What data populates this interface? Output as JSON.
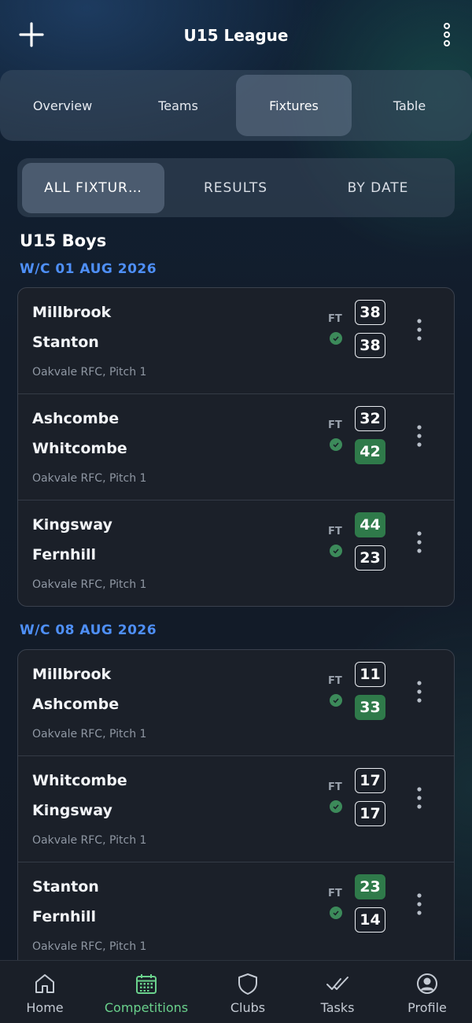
{
  "header": {
    "title": "U15 League"
  },
  "tabs": [
    {
      "label": "Overview"
    },
    {
      "label": "Teams"
    },
    {
      "label": "Fixtures"
    },
    {
      "label": "Table"
    }
  ],
  "filters": [
    {
      "label": "ALL FIXTUR…"
    },
    {
      "label": "RESULTS"
    },
    {
      "label": "BY DATE"
    }
  ],
  "group": {
    "title": "U15 Boys"
  },
  "weeks": [
    {
      "label": "W/C 01 AUG 2026",
      "matches": [
        {
          "home": "Millbrook",
          "away": "Stanton",
          "venue": "Oakvale RFC, Pitch 1",
          "status": "FT",
          "home_score": "38",
          "away_score": "38",
          "winner": "none"
        },
        {
          "home": "Ashcombe",
          "away": "Whitcombe",
          "venue": "Oakvale RFC, Pitch 1",
          "status": "FT",
          "home_score": "32",
          "away_score": "42",
          "winner": "away"
        },
        {
          "home": "Kingsway",
          "away": "Fernhill",
          "venue": "Oakvale RFC, Pitch 1",
          "status": "FT",
          "home_score": "44",
          "away_score": "23",
          "winner": "home"
        }
      ]
    },
    {
      "label": "W/C 08 AUG 2026",
      "matches": [
        {
          "home": "Millbrook",
          "away": "Ashcombe",
          "venue": "Oakvale RFC, Pitch 1",
          "status": "FT",
          "home_score": "11",
          "away_score": "33",
          "winner": "away"
        },
        {
          "home": "Whitcombe",
          "away": "Kingsway",
          "venue": "Oakvale RFC, Pitch 1",
          "status": "FT",
          "home_score": "17",
          "away_score": "17",
          "winner": "none"
        },
        {
          "home": "Stanton",
          "away": "Fernhill",
          "venue": "Oakvale RFC, Pitch 1",
          "status": "FT",
          "home_score": "23",
          "away_score": "14",
          "winner": "home"
        }
      ]
    }
  ],
  "nav": [
    {
      "label": "Home",
      "icon": "home-icon"
    },
    {
      "label": "Competitions",
      "icon": "calendar-icon"
    },
    {
      "label": "Clubs",
      "icon": "shield-icon"
    },
    {
      "label": "Tasks",
      "icon": "double-check-icon"
    },
    {
      "label": "Profile",
      "icon": "profile-icon"
    }
  ],
  "colors": {
    "accent_blue": "#4e8ff7",
    "win_green": "#2f7a4a",
    "nav_active": "#6ad18c"
  }
}
